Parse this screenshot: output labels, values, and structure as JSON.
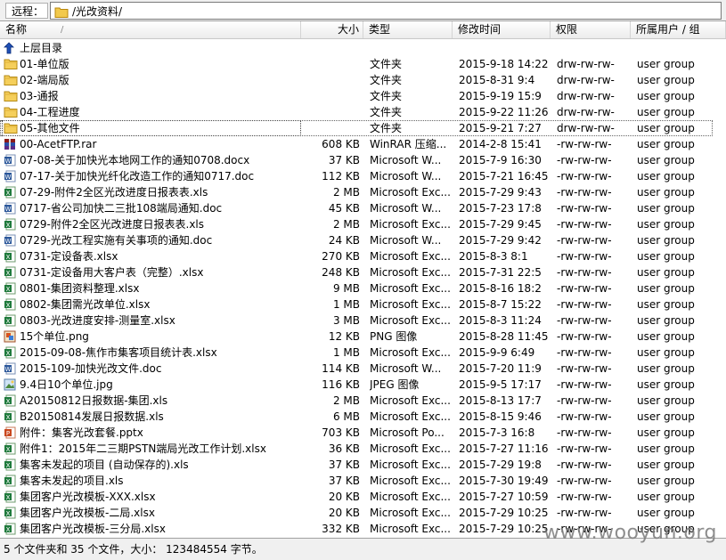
{
  "path_bar": {
    "label": "远程：",
    "path": "/光改资料/"
  },
  "columns": {
    "name": "名称",
    "sort_mark": "/",
    "size": "大小",
    "type": "类型",
    "date": "修改时间",
    "perm": "权限",
    "owner": "所属用户 / 组"
  },
  "files": [
    {
      "icon": "up-folder-icon",
      "name": "上层目录",
      "size": "",
      "type": "",
      "date": "",
      "perm": "",
      "owner": ""
    },
    {
      "icon": "folder-icon",
      "name": "01-单位版",
      "size": "",
      "type": "文件夹",
      "date": "2015-9-18 14:22",
      "perm": "drw-rw-rw-",
      "owner": "user group"
    },
    {
      "icon": "folder-icon",
      "name": "02-端局版",
      "size": "",
      "type": "文件夹",
      "date": "2015-8-31 9:4",
      "perm": "drw-rw-rw-",
      "owner": "user group"
    },
    {
      "icon": "folder-icon",
      "name": "03-通报",
      "size": "",
      "type": "文件夹",
      "date": "2015-9-19 15:9",
      "perm": "drw-rw-rw-",
      "owner": "user group"
    },
    {
      "icon": "folder-icon",
      "name": "04-工程进度",
      "size": "",
      "type": "文件夹",
      "date": "2015-9-22 11:26",
      "perm": "drw-rw-rw-",
      "owner": "user group"
    },
    {
      "icon": "folder-icon",
      "name": "05-其他文件",
      "size": "",
      "type": "文件夹",
      "date": "2015-9-21 7:27",
      "perm": "drw-rw-rw-",
      "owner": "user group"
    },
    {
      "icon": "rar-icon",
      "name": "00-AcetFTP.rar",
      "size": "608 KB",
      "type": "WinRAR 压缩...",
      "date": "2014-2-8 15:41",
      "perm": "-rw-rw-rw-",
      "owner": "user group"
    },
    {
      "icon": "word-icon",
      "name": "07-08-关于加快光本地网工作的通知0708.docx",
      "size": "37 KB",
      "type": "Microsoft W...",
      "date": "2015-7-9 16:30",
      "perm": "-rw-rw-rw-",
      "owner": "user group"
    },
    {
      "icon": "word-icon",
      "name": "07-17-关于加快光纤化改造工作的通知0717.doc",
      "size": "112 KB",
      "type": "Microsoft W...",
      "date": "2015-7-21 16:45",
      "perm": "-rw-rw-rw-",
      "owner": "user group"
    },
    {
      "icon": "excel-icon",
      "name": "07-29-附件2全区光改进度日报表表.xls",
      "size": "2 MB",
      "type": "Microsoft Exc...",
      "date": "2015-7-29 9:43",
      "perm": "-rw-rw-rw-",
      "owner": "user group"
    },
    {
      "icon": "word-icon",
      "name": "0717-省公司加快二三批108端局通知.doc",
      "size": "45 KB",
      "type": "Microsoft W...",
      "date": "2015-7-23 17:8",
      "perm": "-rw-rw-rw-",
      "owner": "user group"
    },
    {
      "icon": "excel-icon",
      "name": "0729-附件2全区光改进度日报表表.xls",
      "size": "2 MB",
      "type": "Microsoft Exc...",
      "date": "2015-7-29 9:45",
      "perm": "-rw-rw-rw-",
      "owner": "user group"
    },
    {
      "icon": "word-icon",
      "name": "0729-光改工程实施有关事项的通知.doc",
      "size": "24 KB",
      "type": "Microsoft W...",
      "date": "2015-7-29 9:42",
      "perm": "-rw-rw-rw-",
      "owner": "user group"
    },
    {
      "icon": "excel-icon",
      "name": "0731-定设备表.xlsx",
      "size": "270 KB",
      "type": "Microsoft Exc...",
      "date": "2015-8-3 8:1",
      "perm": "-rw-rw-rw-",
      "owner": "user group"
    },
    {
      "icon": "excel-icon",
      "name": "0731-定设备用大客户表（完整）.xlsx",
      "size": "248 KB",
      "type": "Microsoft Exc...",
      "date": "2015-7-31 22:5",
      "perm": "-rw-rw-rw-",
      "owner": "user group"
    },
    {
      "icon": "excel-icon",
      "name": "0801-集团资料整理.xlsx",
      "size": "9 MB",
      "type": "Microsoft Exc...",
      "date": "2015-8-16 18:2",
      "perm": "-rw-rw-rw-",
      "owner": "user group"
    },
    {
      "icon": "excel-icon",
      "name": "0802-集团需光改单位.xlsx",
      "size": "1 MB",
      "type": "Microsoft Exc...",
      "date": "2015-8-7 15:22",
      "perm": "-rw-rw-rw-",
      "owner": "user group"
    },
    {
      "icon": "excel-icon",
      "name": "0803-光改进度安排-测量室.xlsx",
      "size": "3 MB",
      "type": "Microsoft Exc...",
      "date": "2015-8-3 11:24",
      "perm": "-rw-rw-rw-",
      "owner": "user group"
    },
    {
      "icon": "png-icon",
      "name": "15个单位.png",
      "size": "12 KB",
      "type": "PNG 图像",
      "date": "2015-8-28 11:45",
      "perm": "-rw-rw-rw-",
      "owner": "user group"
    },
    {
      "icon": "excel-icon",
      "name": "2015-09-08-焦作市集客项目统计表.xlsx",
      "size": "1 MB",
      "type": "Microsoft Exc...",
      "date": "2015-9-9 6:49",
      "perm": "-rw-rw-rw-",
      "owner": "user group"
    },
    {
      "icon": "word-icon",
      "name": "2015-109-加快光改文件.doc",
      "size": "114 KB",
      "type": "Microsoft W...",
      "date": "2015-7-20 11:9",
      "perm": "-rw-rw-rw-",
      "owner": "user group"
    },
    {
      "icon": "jpeg-icon",
      "name": "9.4日10个单位.jpg",
      "size": "116 KB",
      "type": "JPEG 图像",
      "date": "2015-9-5 17:17",
      "perm": "-rw-rw-rw-",
      "owner": "user group"
    },
    {
      "icon": "excel-icon",
      "name": "A20150812日报数据-集团.xls",
      "size": "2 MB",
      "type": "Microsoft Exc...",
      "date": "2015-8-13 17:7",
      "perm": "-rw-rw-rw-",
      "owner": "user group"
    },
    {
      "icon": "excel-icon",
      "name": "B20150814发展日报数据.xls",
      "size": "6 MB",
      "type": "Microsoft Exc...",
      "date": "2015-8-15 9:46",
      "perm": "-rw-rw-rw-",
      "owner": "user group"
    },
    {
      "icon": "ppt-icon",
      "name": "附件：集客光改套餐.pptx",
      "size": "703 KB",
      "type": "Microsoft Po...",
      "date": "2015-7-3 16:8",
      "perm": "-rw-rw-rw-",
      "owner": "user group"
    },
    {
      "icon": "excel-icon",
      "name": "附件1：2015年二三期PSTN端局光改工作计划.xlsx",
      "size": "36 KB",
      "type": "Microsoft Exc...",
      "date": "2015-7-27 11:16",
      "perm": "-rw-rw-rw-",
      "owner": "user group"
    },
    {
      "icon": "excel-icon",
      "name": "集客未发起的项目 (自动保存的).xls",
      "size": "37 KB",
      "type": "Microsoft Exc...",
      "date": "2015-7-29 19:8",
      "perm": "-rw-rw-rw-",
      "owner": "user group"
    },
    {
      "icon": "excel-icon",
      "name": "集客未发起的项目.xls",
      "size": "37 KB",
      "type": "Microsoft Exc...",
      "date": "2015-7-30 19:49",
      "perm": "-rw-rw-rw-",
      "owner": "user group"
    },
    {
      "icon": "excel-icon",
      "name": "集团客户光改模板-XXX.xlsx",
      "size": "20 KB",
      "type": "Microsoft Exc...",
      "date": "2015-7-27 10:59",
      "perm": "-rw-rw-rw-",
      "owner": "user group"
    },
    {
      "icon": "excel-icon",
      "name": "集团客户光改模板-二局.xlsx",
      "size": "20 KB",
      "type": "Microsoft Exc...",
      "date": "2015-7-29 10:25",
      "perm": "-rw-rw-rw-",
      "owner": "user group"
    },
    {
      "icon": "excel-icon",
      "name": "集团客户光改模板-三分局.xlsx",
      "size": "332 KB",
      "type": "Microsoft Exc...",
      "date": "2015-7-29 10:25",
      "perm": "-rw-rw-rw-",
      "owner": "user group"
    }
  ],
  "focused_row": 5,
  "status": "5 个文件夹和 35 个文件，大小： 123484554 字节。",
  "watermark": "www.wooyun.org"
}
